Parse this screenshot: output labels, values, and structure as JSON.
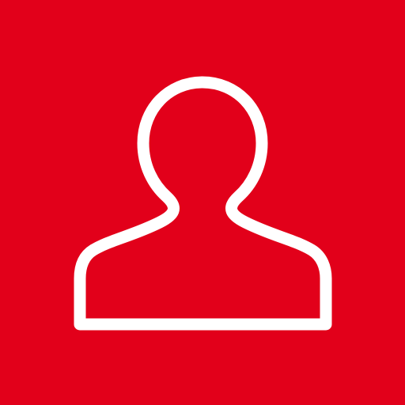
{
  "app_icon": {
    "name": "user-icon",
    "background_color": "#e2001a",
    "foreground_color": "#ffffff"
  }
}
